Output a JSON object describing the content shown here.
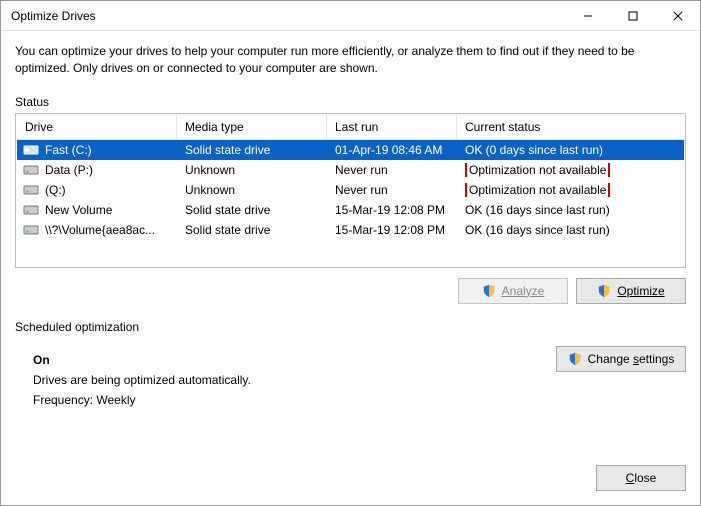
{
  "window": {
    "title": "Optimize Drives"
  },
  "description": "You can optimize your drives to help your computer run more efficiently, or analyze them to find out if they need to be optimized. Only drives on or connected to your computer are shown.",
  "status_label": "Status",
  "columns": {
    "drive": "Drive",
    "media": "Media type",
    "last": "Last run",
    "current": "Current status"
  },
  "rows": [
    {
      "name": "Fast (C:)",
      "media": "Solid state drive",
      "last": "01-Apr-19 08:46 AM",
      "status": "OK (0 days since last run)",
      "selected": true,
      "icon": "ssd"
    },
    {
      "name": "Data (P:)",
      "media": "Unknown",
      "last": "Never run",
      "status": "Optimization not available",
      "selected": false,
      "icon": "hdd",
      "highlight": true
    },
    {
      "name": "(Q:)",
      "media": "Unknown",
      "last": "Never run",
      "status": "Optimization not available",
      "selected": false,
      "icon": "hdd",
      "highlight": true
    },
    {
      "name": "New Volume",
      "media": "Solid state drive",
      "last": "15-Mar-19 12:08 PM",
      "status": "OK (16 days since last run)",
      "selected": false,
      "icon": "hdd"
    },
    {
      "name": "\\\\?\\Volume{aea8ac...",
      "media": "Solid state drive",
      "last": "15-Mar-19 12:08 PM",
      "status": "OK (16 days since last run)",
      "selected": false,
      "icon": "hdd"
    }
  ],
  "buttons": {
    "analyze": "Analyze",
    "optimize": "Optimize",
    "change_settings": "Change settings",
    "close": "Close"
  },
  "scheduled": {
    "label": "Scheduled optimization",
    "state": "On",
    "line1": "Drives are being optimized automatically.",
    "line2": "Frequency: Weekly"
  }
}
